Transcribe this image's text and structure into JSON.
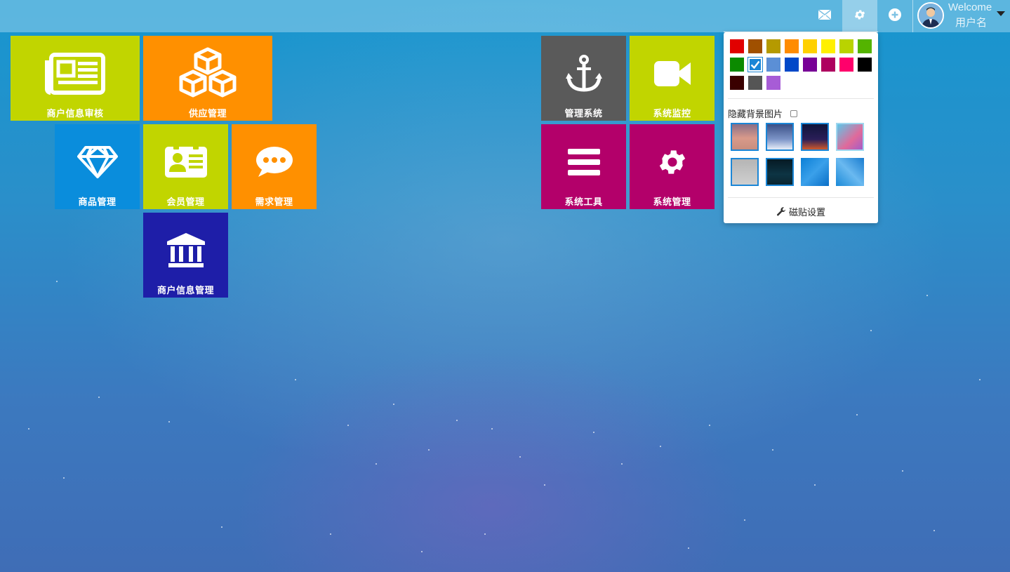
{
  "topbar": {
    "mail_icon": "mail-icon",
    "gear_icon": "gear-icon",
    "plus_icon": "plus-circle-icon",
    "welcome": "Welcome",
    "username": "用户名"
  },
  "tiles": [
    {
      "label": "商户信息审核",
      "icon": "newspaper-icon",
      "color": "#c1d500"
    },
    {
      "label": "供应管理",
      "icon": "cubes-icon",
      "color": "#ff9000"
    },
    {
      "label": "商品管理",
      "icon": "diamond-icon",
      "color": "#0a8ddc"
    },
    {
      "label": "会员管理",
      "icon": "contact-card-icon",
      "color": "#c1d500"
    },
    {
      "label": "需求管理",
      "icon": "chat-bubble-icon",
      "color": "#ff9000"
    },
    {
      "label": "商户信息管理",
      "icon": "bank-icon",
      "color": "#1e1ea8"
    },
    {
      "label": "管理系统",
      "icon": "anchor-icon",
      "color": "#5a5a5a"
    },
    {
      "label": "系统监控",
      "icon": "video-camera-icon",
      "color": "#c1d500"
    },
    {
      "label": "系统工具",
      "icon": "bars-icon",
      "color": "#b3006a"
    },
    {
      "label": "系统管理",
      "icon": "gear-icon",
      "color": "#b3006a"
    }
  ],
  "settings": {
    "colors": [
      "#e10000",
      "#a05000",
      "#b59a00",
      "#ff8c00",
      "#ffd000",
      "#fff000",
      "#b9d300",
      "#54b400",
      "#0b8a00",
      "#1b86d6",
      "#5b8fd6",
      "#0048c8",
      "#780096",
      "#ae005f",
      "#ff006b",
      "#000000",
      "#3a0000",
      "#555555",
      "#a75cd6"
    ],
    "selected_color_index": 9,
    "hide_bg_label": "隐藏背景图片",
    "hide_bg_checked": false,
    "backgrounds": [
      "dusk-pink",
      "blue-mountain",
      "night-city",
      "pink-blue-blur",
      "grey-fog",
      "dark-teal",
      "blue-abstract-1",
      "blue-abstract-2"
    ],
    "tile_settings_icon": "wrench-icon",
    "tile_settings_label": "磁贴设置"
  }
}
